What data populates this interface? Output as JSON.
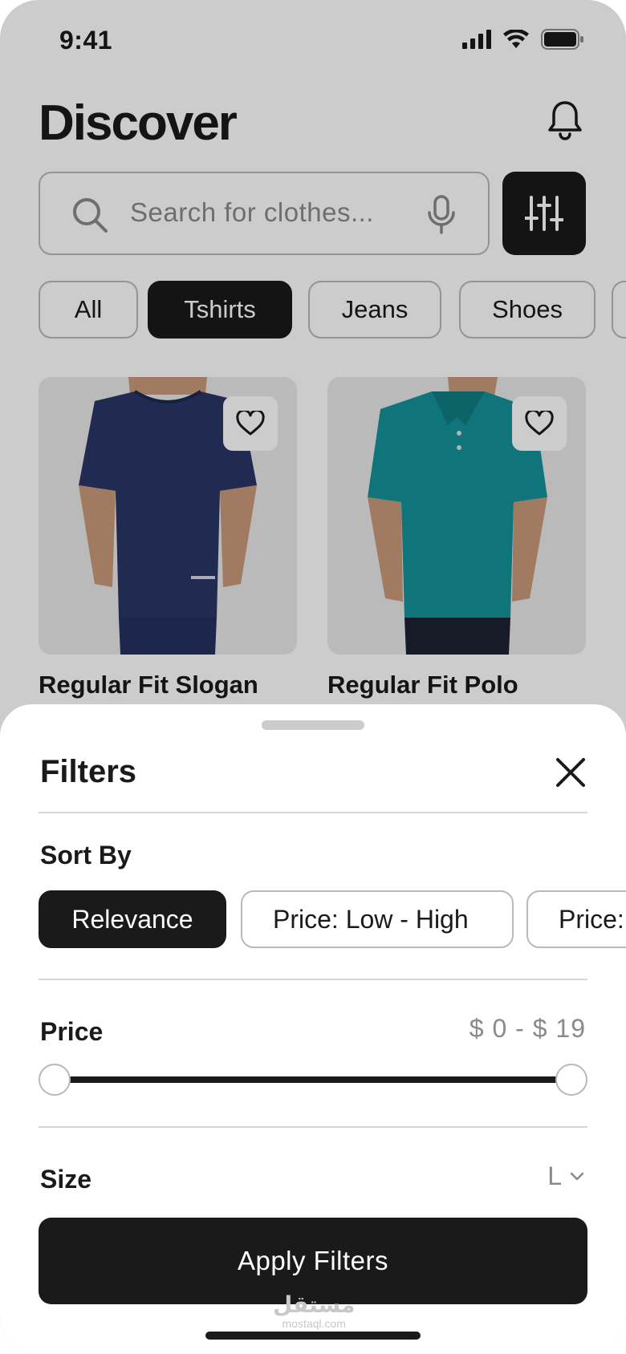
{
  "status_bar": {
    "time": "9:41"
  },
  "header": {
    "title": "Discover"
  },
  "search": {
    "placeholder": "Search for clothes..."
  },
  "categories": [
    {
      "label": "All",
      "active": false
    },
    {
      "label": "Tshirts",
      "active": true
    },
    {
      "label": "Jeans",
      "active": false
    },
    {
      "label": "Shoes",
      "active": false
    }
  ],
  "products": [
    {
      "title": "Regular Fit Slogan",
      "shirt_color": "#2a3566",
      "type": "tshirt"
    },
    {
      "title": "Regular Fit Polo",
      "shirt_color": "#14939a",
      "type": "polo"
    }
  ],
  "filters": {
    "title": "Filters",
    "sort": {
      "label": "Sort By",
      "options": [
        "Relevance",
        "Price: Low - High",
        "Price:"
      ],
      "selected": "Relevance"
    },
    "price": {
      "label": "Price",
      "range_text": "$ 0 - $ 19",
      "min": 0,
      "max": 19
    },
    "size": {
      "label": "Size",
      "value": "L"
    },
    "apply_label": "Apply Filters"
  },
  "watermark": {
    "arabic": "مستقل",
    "site": "mostaql.com"
  },
  "colors": {
    "accent": "#1a1a1a",
    "border": "#b9b9b9",
    "muted_text": "#8a8a8a"
  }
}
